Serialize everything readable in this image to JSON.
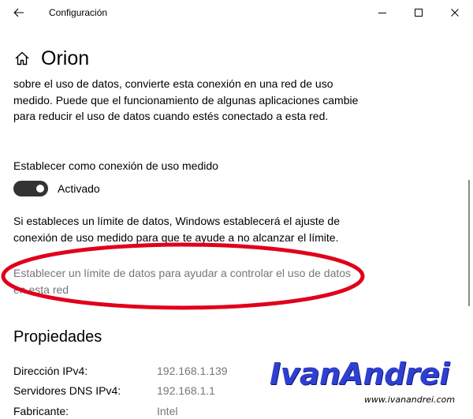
{
  "window": {
    "title": "Configuración"
  },
  "header": {
    "title": "Orion"
  },
  "main": {
    "paragraph_top": "sobre el uso de datos, convierte esta conexión en una red de uso medido. Puede que el funcionamiento de algunas aplicaciones cambie para reducir el uso de datos cuando estés conectado a esta red.",
    "metered_label": "Establecer como conexión de uso medido",
    "toggle_state": "Activado",
    "toggle_on": true,
    "paragraph_limit": "Si estableces un límite de datos, Windows establecerá el ajuste de conexión de uso medido para que te ayude a no alcanzar el límite.",
    "limit_link": "Establecer un límite de datos para ayudar a controlar el uso de datos en esta red"
  },
  "properties": {
    "title": "Propiedades",
    "rows": [
      {
        "key": "Dirección IPv4:",
        "value": "192.168.1.139"
      },
      {
        "key": "Servidores DNS IPv4:",
        "value": "192.168.1.1"
      },
      {
        "key": "Fabricante:",
        "value": "Intel"
      }
    ]
  },
  "watermark": {
    "logo": "IvanAndrei",
    "url": "www.ivanandrei.com"
  },
  "colors": {
    "toggle_on": "#333333",
    "annotation_ellipse": "#e0001b",
    "secondary_text": "#767676",
    "watermark_blue": "#2f3fd0"
  },
  "icons": {
    "back": "arrow-left-icon",
    "home": "home-icon",
    "minimize": "minimize-icon",
    "maximize": "maximize-icon",
    "close": "close-icon"
  }
}
